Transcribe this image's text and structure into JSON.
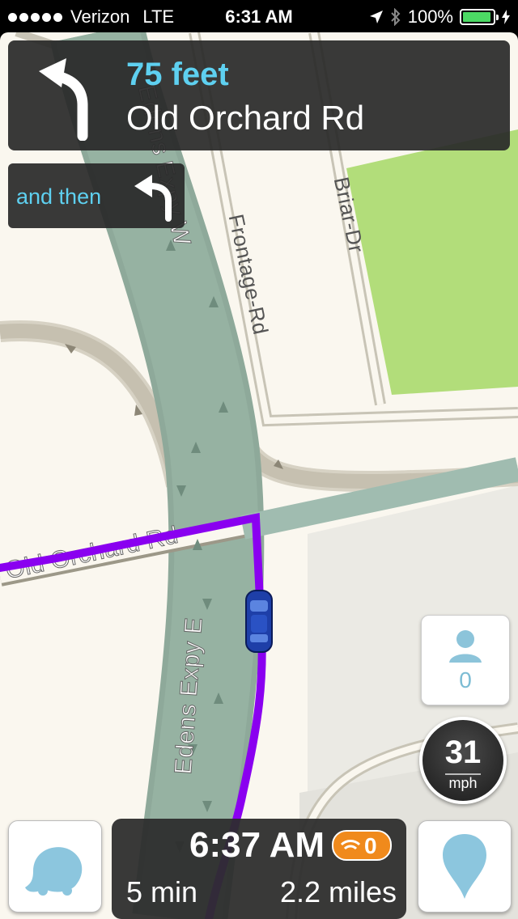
{
  "status_bar": {
    "carrier": "Verizon",
    "network": "LTE",
    "time": "6:31 AM",
    "battery": "100%"
  },
  "navigation": {
    "distance": "75 feet",
    "street": "Old Orchard Rd",
    "then_label": "and then"
  },
  "map": {
    "labels": {
      "edens_expy_w": "Edens Expy W",
      "frontage_rd": "Frontage-Rd",
      "briar_dr": "Briar-Dr",
      "old_orchard_rd": "Old Orchard Rd",
      "edens_expy_e": "Edens Expy E"
    }
  },
  "widgets": {
    "nearby_users": "0",
    "speed": "31",
    "speed_unit": "mph"
  },
  "eta": {
    "arrival_time": "6:37 AM",
    "reports_count": "0",
    "minutes": "5 min",
    "distance": "2.2 miles"
  },
  "colors": {
    "accent_blue": "#5ed0f0",
    "route_purple": "#8a00f0",
    "badge_orange": "#f08a1c"
  }
}
